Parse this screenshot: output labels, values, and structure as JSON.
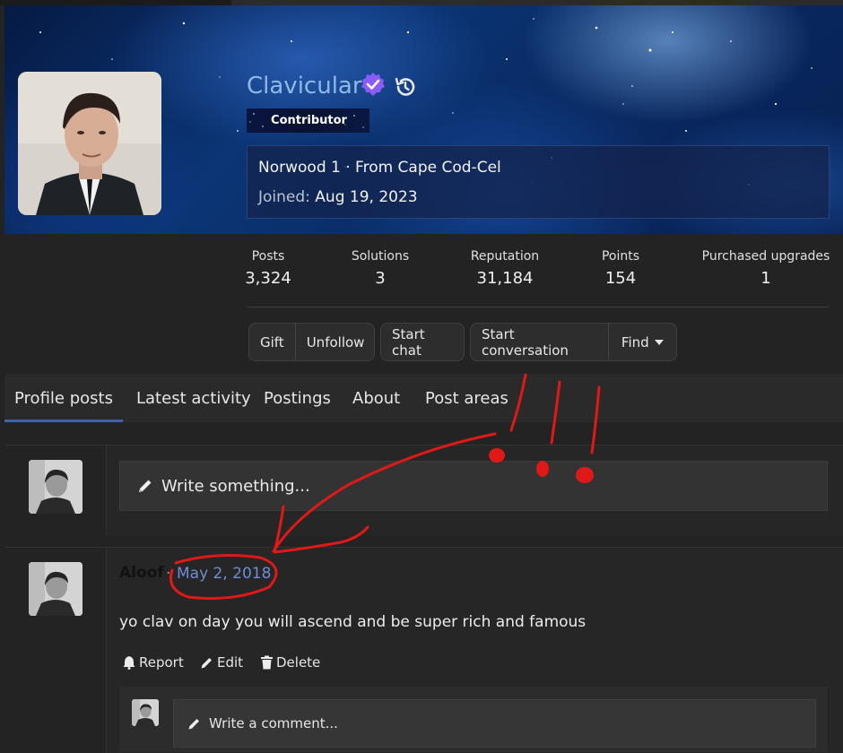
{
  "profile": {
    "username": "Clavicular",
    "verified_icon": "verified-check-icon",
    "history_icon": "history-icon",
    "badge": "Contributor",
    "location_line": "Norwood 1 · From Cape Cod-Cel",
    "joined_label": "Joined:",
    "joined_date": "Aug 19, 2023"
  },
  "stats": [
    {
      "label": "Posts",
      "value": "3,324"
    },
    {
      "label": "Solutions",
      "value": "3"
    },
    {
      "label": "Reputation",
      "value": "31,184"
    },
    {
      "label": "Points",
      "value": "154"
    },
    {
      "label": "Purchased upgrades",
      "value": "1"
    }
  ],
  "actions": {
    "gift": "Gift",
    "unfollow": "Unfollow",
    "start_chat": "Start chat",
    "start_conversation": "Start conversation",
    "find": "Find"
  },
  "tabs": [
    {
      "label": "Profile posts",
      "active": true
    },
    {
      "label": "Latest activity"
    },
    {
      "label": "Postings"
    },
    {
      "label": "About"
    },
    {
      "label": "Post areas"
    }
  ],
  "composer": {
    "placeholder": "Write something..."
  },
  "post": {
    "author": "Aloof",
    "separator": "·",
    "date": "May 2, 2018",
    "body": "yo clav on day you will ascend and be super rich and famous",
    "report": "Report",
    "edit": "Edit",
    "delete": "Delete"
  },
  "comment": {
    "placeholder": "Write a comment..."
  },
  "colors": {
    "accent": "#3f63a8",
    "username": "#8fb8e6",
    "date_link": "#6f8dd6",
    "annotation": "#e01818",
    "verified": "#8a5cf6"
  }
}
